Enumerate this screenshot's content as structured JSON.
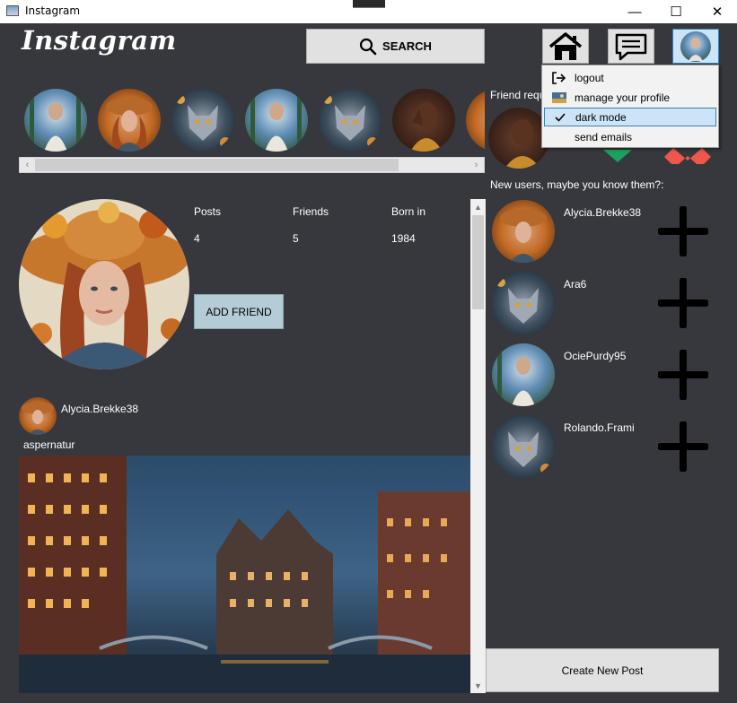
{
  "window": {
    "title": "Instagram"
  },
  "header": {
    "logo": "Instagram",
    "search_label": "SEARCH"
  },
  "menu": {
    "items": [
      {
        "label": "logout",
        "icon": "logout-icon"
      },
      {
        "label": "manage your profile",
        "icon": "profile-thumb-icon"
      },
      {
        "label": "dark mode",
        "icon": "checkmark-icon",
        "checked": true
      },
      {
        "label": "send emails",
        "icon": ""
      }
    ]
  },
  "profile": {
    "stats": [
      {
        "label": "Posts",
        "value": "4"
      },
      {
        "label": "Friends",
        "value": "5"
      },
      {
        "label": "Born in",
        "value": "1984"
      }
    ],
    "add_friend_label": "ADD FRIEND"
  },
  "post": {
    "author": "Alycia.Brekke38",
    "caption": "aspernatur"
  },
  "right_panel": {
    "friend_requests_label": "Friend requ",
    "new_users_label": "New users, maybe you know them?:",
    "users": [
      {
        "name": "Alycia.Brekke38",
        "avatar": "autumn"
      },
      {
        "name": "Ara6",
        "avatar": "wolf"
      },
      {
        "name": "OciePurdy95",
        "avatar": "forest"
      },
      {
        "name": "Rolando.Frami",
        "avatar": "wolf"
      }
    ],
    "create_post_label": "Create New Post"
  },
  "colors": {
    "background": "#36383d",
    "accept": "#1aa35a",
    "reject": "#f0564a"
  }
}
